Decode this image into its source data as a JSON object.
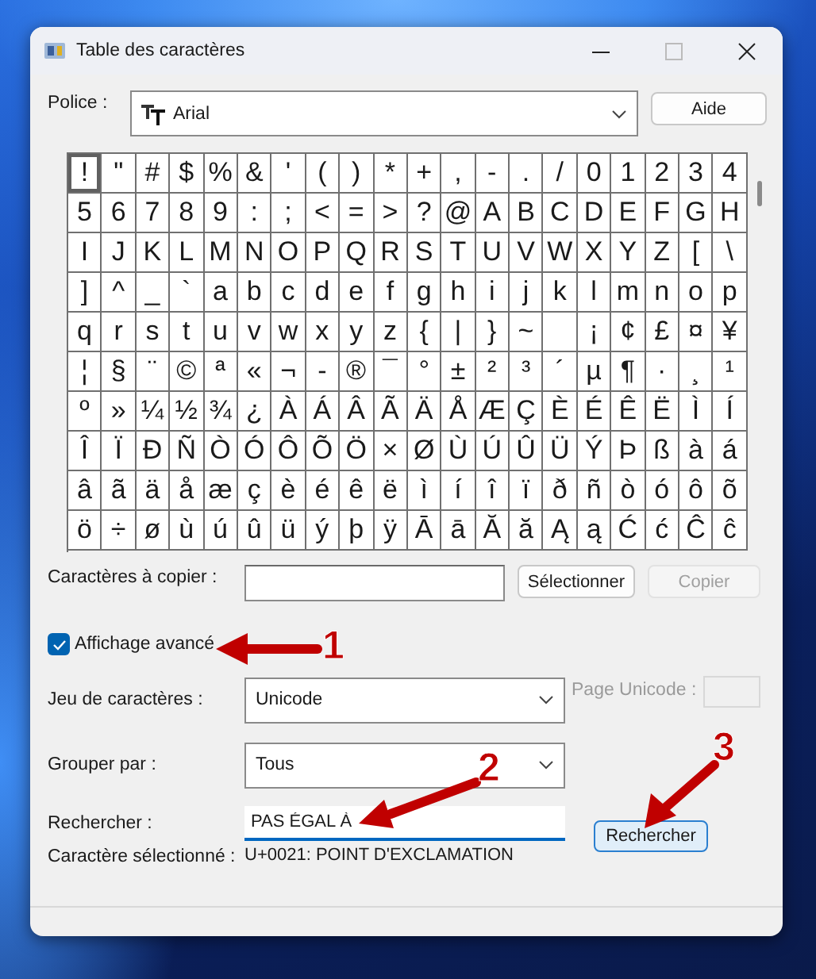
{
  "window": {
    "title": "Table des caractères"
  },
  "font": {
    "label": "Police :",
    "value": "Arial"
  },
  "help_button": {
    "label": "Aide"
  },
  "grid": {
    "rows": [
      [
        {
          "char": "!",
          "selected": true
        },
        {
          "char": "\"",
          "selected": false
        },
        {
          "char": "#",
          "selected": false
        },
        {
          "char": "$",
          "selected": false
        },
        {
          "char": "%",
          "selected": false
        },
        {
          "char": "&",
          "selected": false
        },
        {
          "char": "'",
          "selected": false
        },
        {
          "char": "(",
          "selected": false
        },
        {
          "char": ")",
          "selected": false
        },
        {
          "char": "*",
          "selected": false
        },
        {
          "char": "+",
          "selected": false
        },
        {
          "char": ",",
          "selected": false
        },
        {
          "char": "-",
          "selected": false
        },
        {
          "char": ".",
          "selected": false
        },
        {
          "char": "/",
          "selected": false
        },
        {
          "char": "0",
          "selected": false
        },
        {
          "char": "1",
          "selected": false
        },
        {
          "char": "2",
          "selected": false
        },
        {
          "char": "3",
          "selected": false
        },
        {
          "char": "4",
          "selected": false
        }
      ],
      [
        {
          "char": "5",
          "selected": false
        },
        {
          "char": "6",
          "selected": false
        },
        {
          "char": "7",
          "selected": false
        },
        {
          "char": "8",
          "selected": false
        },
        {
          "char": "9",
          "selected": false
        },
        {
          "char": ":",
          "selected": false
        },
        {
          "char": ";",
          "selected": false
        },
        {
          "char": "<",
          "selected": false
        },
        {
          "char": "=",
          "selected": false
        },
        {
          "char": ">",
          "selected": false
        },
        {
          "char": "?",
          "selected": false
        },
        {
          "char": "@",
          "selected": false
        },
        {
          "char": "A",
          "selected": false
        },
        {
          "char": "B",
          "selected": false
        },
        {
          "char": "C",
          "selected": false
        },
        {
          "char": "D",
          "selected": false
        },
        {
          "char": "E",
          "selected": false
        },
        {
          "char": "F",
          "selected": false
        },
        {
          "char": "G",
          "selected": false
        },
        {
          "char": "H",
          "selected": false
        }
      ],
      [
        {
          "char": "I",
          "selected": false
        },
        {
          "char": "J",
          "selected": false
        },
        {
          "char": "K",
          "selected": false
        },
        {
          "char": "L",
          "selected": false
        },
        {
          "char": "M",
          "selected": false
        },
        {
          "char": "N",
          "selected": false
        },
        {
          "char": "O",
          "selected": false
        },
        {
          "char": "P",
          "selected": false
        },
        {
          "char": "Q",
          "selected": false
        },
        {
          "char": "R",
          "selected": false
        },
        {
          "char": "S",
          "selected": false
        },
        {
          "char": "T",
          "selected": false
        },
        {
          "char": "U",
          "selected": false
        },
        {
          "char": "V",
          "selected": false
        },
        {
          "char": "W",
          "selected": false
        },
        {
          "char": "X",
          "selected": false
        },
        {
          "char": "Y",
          "selected": false
        },
        {
          "char": "Z",
          "selected": false
        },
        {
          "char": "[",
          "selected": false
        },
        {
          "char": "\\",
          "selected": false
        }
      ],
      [
        {
          "char": "]",
          "selected": false
        },
        {
          "char": "^",
          "selected": false
        },
        {
          "char": "_",
          "selected": false
        },
        {
          "char": "`",
          "selected": false
        },
        {
          "char": "a",
          "selected": false
        },
        {
          "char": "b",
          "selected": false
        },
        {
          "char": "c",
          "selected": false
        },
        {
          "char": "d",
          "selected": false
        },
        {
          "char": "e",
          "selected": false
        },
        {
          "char": "f",
          "selected": false
        },
        {
          "char": "g",
          "selected": false
        },
        {
          "char": "h",
          "selected": false
        },
        {
          "char": "i",
          "selected": false
        },
        {
          "char": "j",
          "selected": false
        },
        {
          "char": "k",
          "selected": false
        },
        {
          "char": "l",
          "selected": false
        },
        {
          "char": "m",
          "selected": false
        },
        {
          "char": "n",
          "selected": false
        },
        {
          "char": "o",
          "selected": false
        },
        {
          "char": "p",
          "selected": false
        }
      ],
      [
        {
          "char": "q",
          "selected": false
        },
        {
          "char": "r",
          "selected": false
        },
        {
          "char": "s",
          "selected": false
        },
        {
          "char": "t",
          "selected": false
        },
        {
          "char": "u",
          "selected": false
        },
        {
          "char": "v",
          "selected": false
        },
        {
          "char": "w",
          "selected": false
        },
        {
          "char": "x",
          "selected": false
        },
        {
          "char": "y",
          "selected": false
        },
        {
          "char": "z",
          "selected": false
        },
        {
          "char": "{",
          "selected": false
        },
        {
          "char": "|",
          "selected": false
        },
        {
          "char": "}",
          "selected": false
        },
        {
          "char": "~",
          "selected": false
        },
        {
          "selected": false
        },
        {
          "char": "¡",
          "selected": false
        },
        {
          "char": "¢",
          "selected": false
        },
        {
          "char": "£",
          "selected": false
        },
        {
          "char": "¤",
          "selected": false
        },
        {
          "char": "¥",
          "selected": false
        }
      ],
      [
        {
          "char": "¦",
          "selected": false
        },
        {
          "char": "§",
          "selected": false
        },
        {
          "char": "¨",
          "selected": false
        },
        {
          "char": "©",
          "selected": false
        },
        {
          "char": "ª",
          "selected": false
        },
        {
          "char": "«",
          "selected": false
        },
        {
          "char": "¬",
          "selected": false
        },
        {
          "char": "-",
          "selected": false
        },
        {
          "char": "®",
          "selected": false
        },
        {
          "char": "¯",
          "selected": false
        },
        {
          "char": "°",
          "selected": false
        },
        {
          "char": "±",
          "selected": false
        },
        {
          "char": "²",
          "selected": false
        },
        {
          "char": "³",
          "selected": false
        },
        {
          "char": "´",
          "selected": false
        },
        {
          "char": "µ",
          "selected": false
        },
        {
          "char": "¶",
          "selected": false
        },
        {
          "char": "·",
          "selected": false
        },
        {
          "char": "¸",
          "selected": false
        },
        {
          "char": "¹",
          "selected": false
        }
      ],
      [
        {
          "char": "º",
          "selected": false
        },
        {
          "char": "»",
          "selected": false
        },
        {
          "char": "¼",
          "selected": false
        },
        {
          "char": "½",
          "selected": false
        },
        {
          "char": "¾",
          "selected": false
        },
        {
          "char": "¿",
          "selected": false
        },
        {
          "char": "À",
          "selected": false
        },
        {
          "char": "Á",
          "selected": false
        },
        {
          "char": "Â",
          "selected": false
        },
        {
          "char": "Ã",
          "selected": false
        },
        {
          "char": "Ä",
          "selected": false
        },
        {
          "char": "Å",
          "selected": false
        },
        {
          "char": "Æ",
          "selected": false
        },
        {
          "char": "Ç",
          "selected": false
        },
        {
          "char": "È",
          "selected": false
        },
        {
          "char": "É",
          "selected": false
        },
        {
          "char": "Ê",
          "selected": false
        },
        {
          "char": "Ë",
          "selected": false
        },
        {
          "char": "Ì",
          "selected": false
        },
        {
          "char": "Í",
          "selected": false
        }
      ],
      [
        {
          "char": "Î",
          "selected": false
        },
        {
          "char": "Ï",
          "selected": false
        },
        {
          "char": "Ð",
          "selected": false
        },
        {
          "char": "Ñ",
          "selected": false
        },
        {
          "char": "Ò",
          "selected": false
        },
        {
          "char": "Ó",
          "selected": false
        },
        {
          "char": "Ô",
          "selected": false
        },
        {
          "char": "Õ",
          "selected": false
        },
        {
          "char": "Ö",
          "selected": false
        },
        {
          "char": "×",
          "selected": false
        },
        {
          "char": "Ø",
          "selected": false
        },
        {
          "char": "Ù",
          "selected": false
        },
        {
          "char": "Ú",
          "selected": false
        },
        {
          "char": "Û",
          "selected": false
        },
        {
          "char": "Ü",
          "selected": false
        },
        {
          "char": "Ý",
          "selected": false
        },
        {
          "char": "Þ",
          "selected": false
        },
        {
          "char": "ß",
          "selected": false
        },
        {
          "char": "à",
          "selected": false
        },
        {
          "char": "á",
          "selected": false
        }
      ],
      [
        {
          "char": "â",
          "selected": false
        },
        {
          "char": "ã",
          "selected": false
        },
        {
          "char": "ä",
          "selected": false
        },
        {
          "char": "å",
          "selected": false
        },
        {
          "char": "æ",
          "selected": false
        },
        {
          "char": "ç",
          "selected": false
        },
        {
          "char": "è",
          "selected": false
        },
        {
          "char": "é",
          "selected": false
        },
        {
          "char": "ê",
          "selected": false
        },
        {
          "char": "ë",
          "selected": false
        },
        {
          "char": "ì",
          "selected": false
        },
        {
          "char": "í",
          "selected": false
        },
        {
          "char": "î",
          "selected": false
        },
        {
          "char": "ï",
          "selected": false
        },
        {
          "char": "ð",
          "selected": false
        },
        {
          "char": "ñ",
          "selected": false
        },
        {
          "char": "ò",
          "selected": false
        },
        {
          "char": "ó",
          "selected": false
        },
        {
          "char": "ô",
          "selected": false
        },
        {
          "char": "õ",
          "selected": false
        }
      ],
      [
        {
          "char": "ö",
          "selected": false
        },
        {
          "char": "÷",
          "selected": false
        },
        {
          "char": "ø",
          "selected": false
        },
        {
          "char": "ù",
          "selected": false
        },
        {
          "char": "ú",
          "selected": false
        },
        {
          "char": "û",
          "selected": false
        },
        {
          "char": "ü",
          "selected": false
        },
        {
          "char": "ý",
          "selected": false
        },
        {
          "char": "þ",
          "selected": false
        },
        {
          "char": "ÿ",
          "selected": false
        },
        {
          "char": "Ā",
          "selected": false
        },
        {
          "char": "ā",
          "selected": false
        },
        {
          "char": "Ă",
          "selected": false
        },
        {
          "char": "ă",
          "selected": false
        },
        {
          "char": "Ą",
          "selected": false
        },
        {
          "char": "ą",
          "selected": false
        },
        {
          "char": "Ć",
          "selected": false
        },
        {
          "char": "ć",
          "selected": false
        },
        {
          "char": "Ĉ",
          "selected": false
        },
        {
          "char": "ĉ",
          "selected": false
        }
      ]
    ]
  },
  "copy": {
    "label": "Caractères à copier :",
    "select_button": "Sélectionner",
    "copy_button": {
      "label": "Copier",
      "disabled": true
    }
  },
  "advanced_view": {
    "label": "Affichage avancé",
    "checked": true
  },
  "charset": {
    "label": "Jeu de caractères :",
    "value": "Unicode"
  },
  "unicode_page": {
    "label": "Page Unicode :",
    "disabled": true
  },
  "group_by": {
    "label": "Grouper par :",
    "value": "Tous"
  },
  "search": {
    "label": "Rechercher :",
    "value": "PAS ÉGAL À",
    "button": "Rechercher"
  },
  "selected_char": {
    "label": "Caractère sélectionné :",
    "value": "U+0021: POINT D'EXCLAMATION"
  },
  "annotations": [
    {
      "number": "1"
    },
    {
      "number": "2"
    },
    {
      "number": "3"
    }
  ]
}
